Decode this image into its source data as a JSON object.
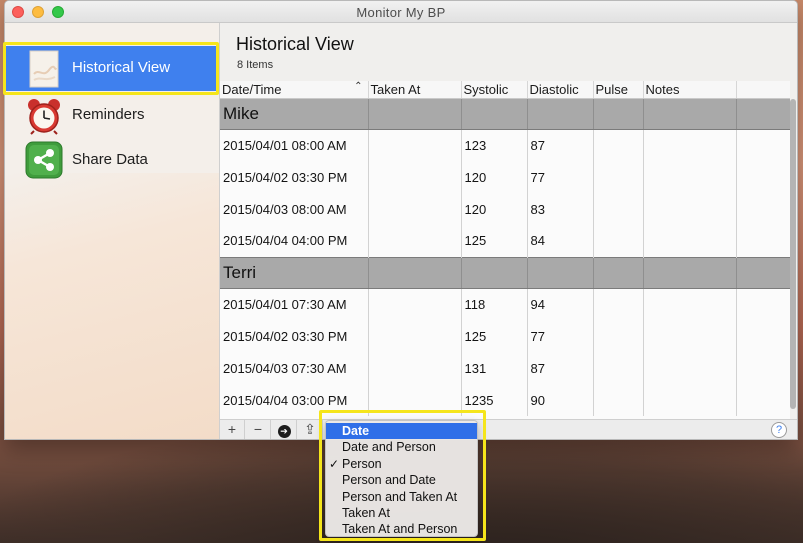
{
  "window": {
    "title": "Monitor My BP"
  },
  "sidebar": {
    "items": [
      {
        "label": "Historical View",
        "icon": "historical-view-icon",
        "selected": true
      },
      {
        "label": "Reminders",
        "icon": "alarm-clock-icon",
        "selected": false
      },
      {
        "label": "Share Data",
        "icon": "share-icon",
        "selected": false
      }
    ]
  },
  "main": {
    "title": "Historical View",
    "count": "8 Items"
  },
  "table": {
    "columns": [
      "Date/Time",
      "Taken At",
      "Systolic",
      "Diastolic",
      "Pulse",
      "Notes"
    ],
    "sorted_column": "Date/Time",
    "groups": [
      {
        "name": "Mike",
        "rows": [
          {
            "datetime": "2015/04/01 08:00 AM",
            "taken_at": "",
            "systolic": "123",
            "diastolic": "87",
            "pulse": "",
            "notes": ""
          },
          {
            "datetime": "2015/04/02 03:30 PM",
            "taken_at": "",
            "systolic": "120",
            "diastolic": "77",
            "pulse": "",
            "notes": ""
          },
          {
            "datetime": "2015/04/03 08:00 AM",
            "taken_at": "",
            "systolic": "120",
            "diastolic": "83",
            "pulse": "",
            "notes": ""
          },
          {
            "datetime": "2015/04/04 04:00 PM",
            "taken_at": "",
            "systolic": "125",
            "diastolic": "84",
            "pulse": "",
            "notes": ""
          }
        ]
      },
      {
        "name": "Terri",
        "rows": [
          {
            "datetime": "2015/04/01 07:30 AM",
            "taken_at": "",
            "systolic": "118",
            "diastolic": "94",
            "pulse": "",
            "notes": ""
          },
          {
            "datetime": "2015/04/02 03:30 PM",
            "taken_at": "",
            "systolic": "125",
            "diastolic": "77",
            "pulse": "",
            "notes": ""
          },
          {
            "datetime": "2015/04/03 07:30 AM",
            "taken_at": "",
            "systolic": "131",
            "diastolic": "87",
            "pulse": "",
            "notes": ""
          },
          {
            "datetime": "2015/04/04 03:00 PM",
            "taken_at": "",
            "systolic": "1235",
            "diastolic": "90",
            "pulse": "",
            "notes": ""
          }
        ]
      }
    ]
  },
  "bottom_bar": {
    "add_label": "+",
    "remove_label": "−",
    "action_label": "➔",
    "share_label": "⇪",
    "help_label": "?"
  },
  "group_menu": {
    "items": [
      {
        "label": "Date",
        "highlighted": true,
        "checked": false
      },
      {
        "label": "Date and Person",
        "highlighted": false,
        "checked": false
      },
      {
        "label": "Person",
        "highlighted": false,
        "checked": true
      },
      {
        "label": "Person and Date",
        "highlighted": false,
        "checked": false
      },
      {
        "label": "Person and Taken At",
        "highlighted": false,
        "checked": false
      },
      {
        "label": "Taken At",
        "highlighted": false,
        "checked": false
      },
      {
        "label": "Taken At and Person",
        "highlighted": false,
        "checked": false
      }
    ],
    "check_glyph": "✓"
  },
  "colors": {
    "selection_blue": "#3f80ee",
    "annotation_yellow": "#f5e51b",
    "group_row_gray": "#a9a9a9"
  }
}
